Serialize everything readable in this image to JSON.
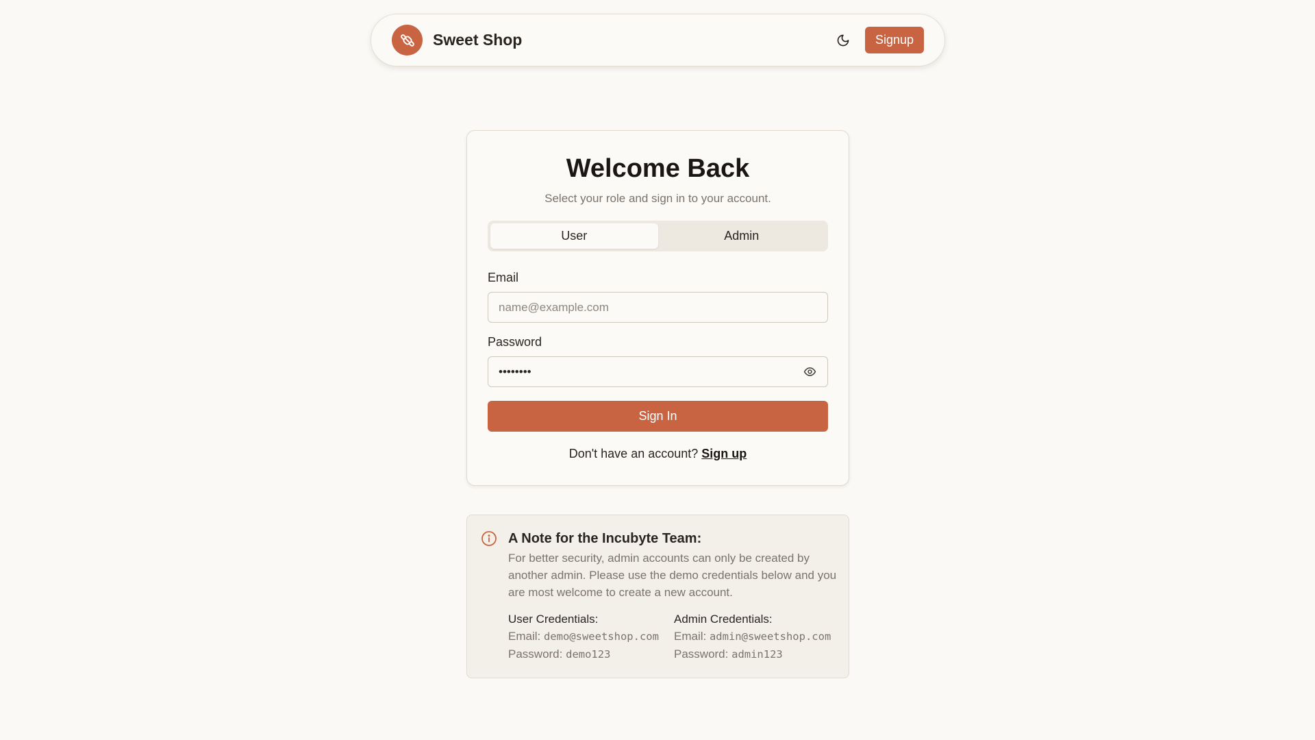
{
  "nav": {
    "brand": "Sweet Shop",
    "signup_label": "Signup"
  },
  "login": {
    "title": "Welcome Back",
    "subtitle": "Select your role and sign in to your account.",
    "roles": [
      {
        "label": "User",
        "selected": true
      },
      {
        "label": "Admin",
        "selected": false
      }
    ],
    "email_label": "Email",
    "email_placeholder": "name@example.com",
    "email_value": "",
    "password_label": "Password",
    "password_value": "••••••••",
    "signin_label": "Sign In",
    "no_account_text": "Don't have an account?",
    "signup_link": "Sign up"
  },
  "note": {
    "title": "A Note for the Incubyte Team:",
    "text": "For better security, admin accounts can only be created by another admin. Please use the demo credentials below and you are most welcome to create a new account.",
    "user": {
      "heading": "User Credentials:",
      "email_label": "Email:",
      "email": "demo@sweetshop.com",
      "password_label": "Password:",
      "password": "demo123"
    },
    "admin": {
      "heading": "Admin Credentials:",
      "email_label": "Email:",
      "email": "admin@sweetshop.com",
      "password_label": "Password:",
      "password": "admin123"
    }
  },
  "colors": {
    "accent": "#c96442",
    "background": "#faf9f6"
  },
  "icons": {
    "logo": "candy-icon",
    "theme": "moon-icon",
    "password_toggle": "eye-icon",
    "note": "info-icon"
  }
}
